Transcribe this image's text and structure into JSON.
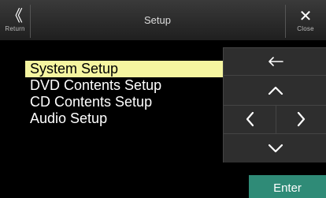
{
  "header": {
    "title": "Setup",
    "return": {
      "icon": "double-chevron-left-icon",
      "glyph": "《",
      "label": "Return"
    },
    "close": {
      "icon": "close-icon",
      "glyph": "✕",
      "label": "Close"
    }
  },
  "menu": {
    "items": [
      {
        "label": "System Setup",
        "selected": true
      },
      {
        "label": "DVD Contents Setup",
        "selected": false
      },
      {
        "label": "CD Contents Setup",
        "selected": false
      },
      {
        "label": "Audio Setup",
        "selected": false
      }
    ]
  },
  "controls": {
    "back_icon": "back-arrow-icon",
    "up_icon": "chevron-up-icon",
    "left_icon": "chevron-left-icon",
    "right_icon": "chevron-right-icon",
    "down_icon": "chevron-down-icon",
    "enter_label": "Enter"
  },
  "colors": {
    "highlight": "#f5f5a0",
    "enter": "#2f8b77",
    "panel": "#2e2e2e"
  }
}
